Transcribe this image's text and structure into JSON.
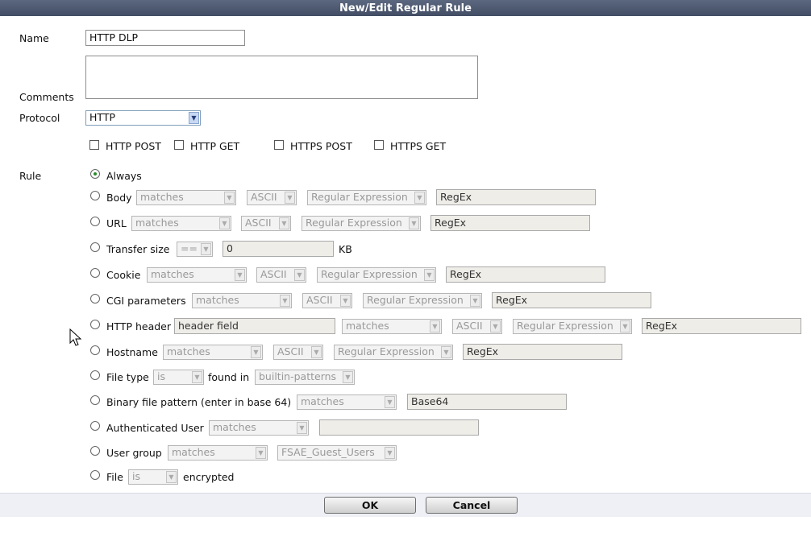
{
  "dialog": {
    "title": "New/Edit Regular Rule"
  },
  "form": {
    "name_label": "Name",
    "name_value": "HTTP DLP",
    "comments_label": "Comments",
    "comments_value": "",
    "protocol_label": "Protocol",
    "protocol_value": "HTTP",
    "checkboxes": [
      {
        "label": "HTTP POST",
        "checked": false
      },
      {
        "label": "HTTP GET",
        "checked": false
      },
      {
        "label": "HTTPS POST",
        "checked": false
      },
      {
        "label": "HTTPS GET",
        "checked": false
      }
    ],
    "rule_label": "Rule"
  },
  "rules": {
    "always": {
      "label": "Always",
      "selected": true
    },
    "body": {
      "label": "Body",
      "op": "matches",
      "enc": "ASCII",
      "type": "Regular Expression",
      "value": "RegEx"
    },
    "url": {
      "label": "URL",
      "op": "matches",
      "enc": "ASCII",
      "type": "Regular Expression",
      "value": "RegEx"
    },
    "transfer_size": {
      "label": "Transfer size",
      "op": "==",
      "value": "0",
      "unit": "KB"
    },
    "cookie": {
      "label": "Cookie",
      "op": "matches",
      "enc": "ASCII",
      "type": "Regular Expression",
      "value": "RegEx"
    },
    "cgi": {
      "label": "CGI parameters",
      "op": "matches",
      "enc": "ASCII",
      "type": "Regular Expression",
      "value": "RegEx"
    },
    "http_header": {
      "label": "HTTP header",
      "field": "header field",
      "op": "matches",
      "enc": "ASCII",
      "type": "Regular Expression",
      "value": "RegEx"
    },
    "hostname": {
      "label": "Hostname",
      "op": "matches",
      "enc": "ASCII",
      "type": "Regular Expression",
      "value": "RegEx"
    },
    "file_type": {
      "label": "File type",
      "op": "is",
      "found_in_label": "found in",
      "source": "builtin-patterns"
    },
    "binary": {
      "label": "Binary file pattern (enter in base 64)",
      "op": "matches",
      "value": "Base64"
    },
    "auth_user": {
      "label": "Authenticated User",
      "op": "matches",
      "value": ""
    },
    "user_group": {
      "label": "User group",
      "op": "matches",
      "group": "FSAE_Guest_Users"
    },
    "file": {
      "label": "File",
      "op": "is",
      "suffix": "encrypted"
    }
  },
  "buttons": {
    "ok": "OK",
    "cancel": "Cancel"
  }
}
